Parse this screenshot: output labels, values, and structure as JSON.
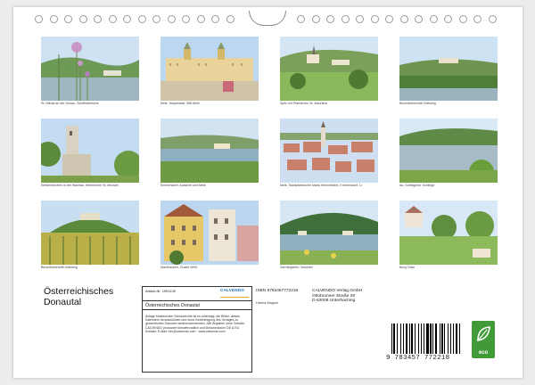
{
  "calendar": {
    "title_line1": "Österreichisches",
    "title_line2": "Donautal"
  },
  "photos": [
    {
      "caption": "St. Nikola an der Donau, Schiffsfahrsche"
    },
    {
      "caption": "Melk, Hauptstadt, Stift Melk"
    },
    {
      "caption": "Spitz mit Pfarrkirche St. Mauritius"
    },
    {
      "caption": "Benediktinerstift Göttweig"
    },
    {
      "caption": "Weißenkirchen in der Wachau, Wehrkirche St. Michael"
    },
    {
      "caption": "Emmersdorf, Aussicht und Melk"
    },
    {
      "caption": "Melk, Stadtpfarrkirche Mariä Himmelfahrt, Emmersdorf, Li"
    },
    {
      "caption": "Au, Schlögener Schlinge"
    },
    {
      "caption": "Benediktinerstift Göttweig"
    },
    {
      "caption": "Mauthausen, Chalet Weiß"
    },
    {
      "caption": "Sarmingstein, Nordufer"
    },
    {
      "caption": "Burg Clam"
    }
  ],
  "info_box": {
    "article_label": "Artikel-Nr.",
    "article_number": "1991139",
    "logo_text": "CALVENDO",
    "title": "Österreichisches Donautal",
    "description": "Anlage bestehender Schutzrechte ist es untersagt, die Bilder, dieses Kalenders herauszulösen und ohne Genehmigung des Verlages zu gewerblichen Zwecken weiterzuverwenden. Alle Angaben ohne Gewähr. CALVENDO produziert klimafreundlich und klimaneutral in DE & EU. Kontakt: E-Mail: info@calvendo.com · www.calvendo.com"
  },
  "publisher_block": {
    "isbn": "ISBN 9783457772218",
    "author": "Hanna Wagner",
    "line1": "CALVENDO Verlag GmbH",
    "line2": "Ottobrunner Straße 39",
    "line3": "D-82008 Unterhaching"
  },
  "barcode": {
    "digits": "9 783457 772218"
  },
  "eco_badge": {
    "label": "eco"
  }
}
